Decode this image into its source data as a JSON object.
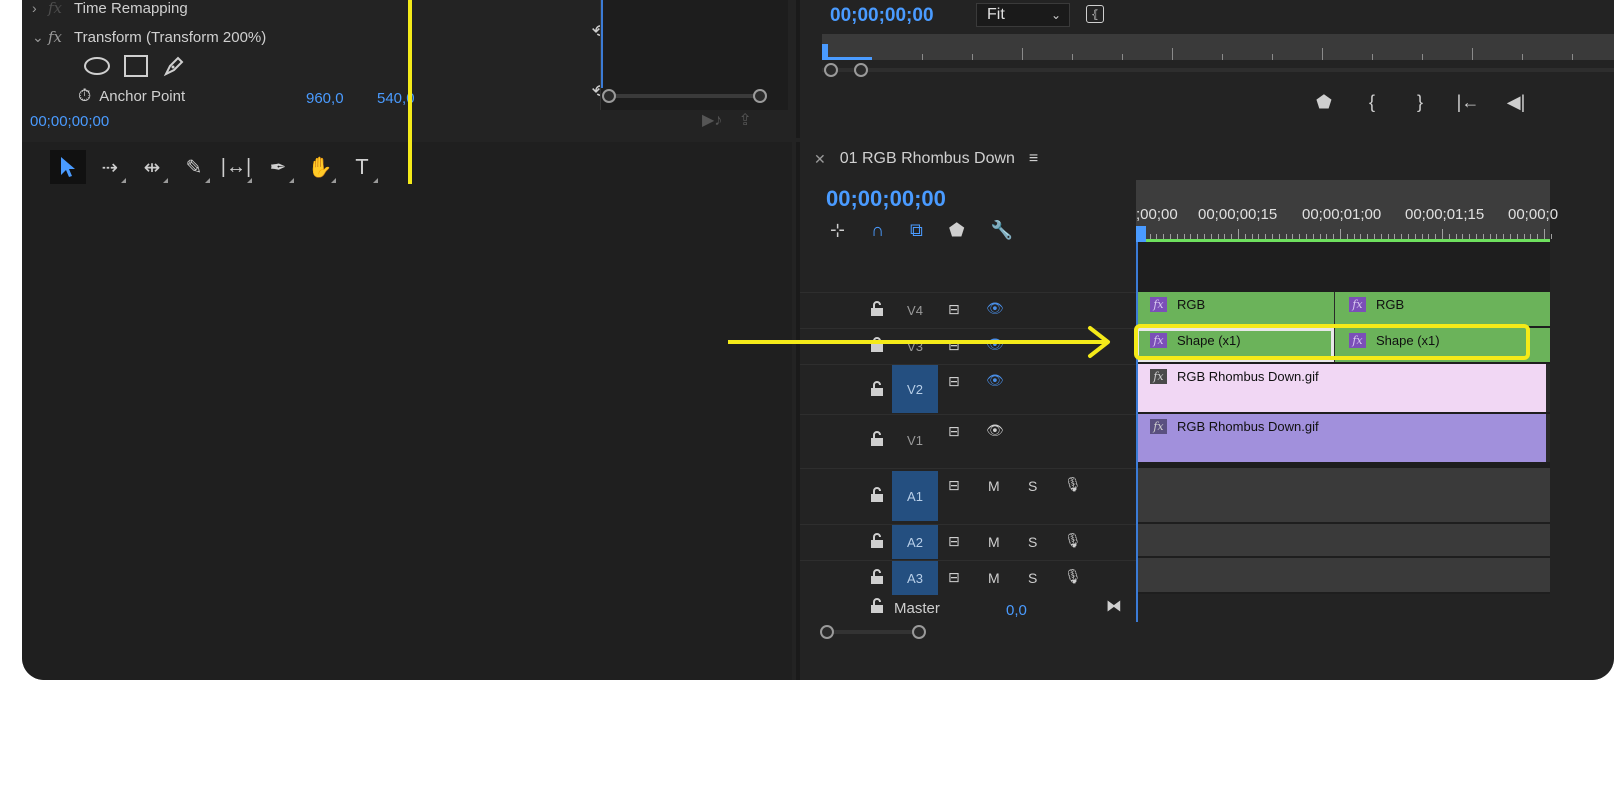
{
  "effect_controls": {
    "time_remapping_label": "Time Remapping",
    "transform_label": "Transform (Transform 200%)",
    "anchor_point_label": "Anchor Point",
    "anchor_x": "960,0",
    "anchor_y": "540,0",
    "timecode": "00;00;00;00",
    "fx_glyph": "fx"
  },
  "program_monitor": {
    "timecode": "00;00;00;00",
    "zoom_select": "Fit"
  },
  "timeline": {
    "sequence_name": "01 RGB Rhombus Down",
    "timecode": "00;00;00;00",
    "ruler_labels": [
      ";00;00",
      "00;00;00;15",
      "00;00;01;00",
      "00;00;01;15",
      "00;00;0"
    ],
    "tracks": {
      "v4": "V4",
      "v3": "V3",
      "v2": "V2",
      "v1": "V1",
      "a1": "A1",
      "a2": "A2",
      "a3": "A3",
      "m": "M",
      "s": "S",
      "master": "Master",
      "master_value": "0,0"
    },
    "clips": {
      "v4_a": "RGB",
      "v4_b": "RGB",
      "v3_a": "Shape (x1)",
      "v3_b": "Shape (x1)",
      "v2": "RGB Rhombus Down.gif",
      "v1": "RGB Rhombus Down.gif",
      "fx": "fx"
    }
  },
  "colors": {
    "accent_blue": "#4a9bff",
    "highlight_yellow": "#f4ea19",
    "clip_green": "#6bb35a",
    "clip_pink": "#f1d7f4",
    "clip_purple": "#a190dc"
  }
}
